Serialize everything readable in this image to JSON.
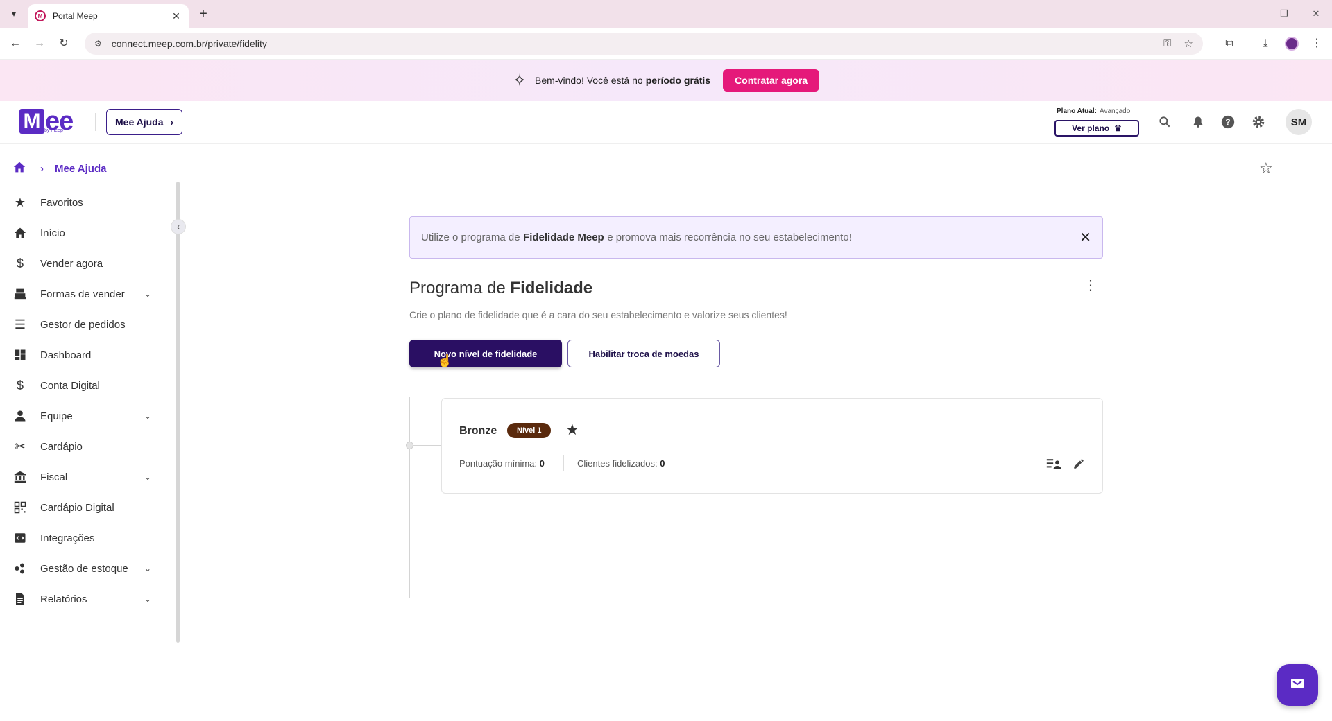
{
  "browser": {
    "tab_title": "Portal Meep",
    "url": "connect.meep.com.br/private/fidelity"
  },
  "promo": {
    "text": "Bem-vindo! Você está no",
    "strong": "período grátis",
    "button": "Contratar agora"
  },
  "header": {
    "logo_text": "ee",
    "logo_sub": "by meep",
    "help_button": "Mee Ajuda",
    "plan_label": "Plano Atual:",
    "plan_value": "Avançado",
    "plan_button": "Ver plano",
    "avatar_initials": "SM"
  },
  "breadcrumb": {
    "current": "Mee Ajuda"
  },
  "sidebar": {
    "items": [
      {
        "label": "Favoritos"
      },
      {
        "label": "Início"
      },
      {
        "label": "Vender agora"
      },
      {
        "label": "Formas de vender"
      },
      {
        "label": "Gestor de pedidos"
      },
      {
        "label": "Dashboard"
      },
      {
        "label": "Conta Digital"
      },
      {
        "label": "Equipe"
      },
      {
        "label": "Cardápio"
      },
      {
        "label": "Fiscal"
      },
      {
        "label": "Cardápio Digital"
      },
      {
        "label": "Integrações"
      },
      {
        "label": "Gestão de estoque"
      },
      {
        "label": "Relatórios"
      }
    ]
  },
  "main": {
    "info_banner": {
      "text_before": "Utilize o programa de",
      "strong": "Fidelidade Meep",
      "text_after": "e promova mais recorrência no seu estabelecimento!"
    },
    "title_prefix": "Programa de",
    "title_strong": "Fidelidade",
    "subtitle": "Crie o plano de fidelidade que é a cara do seu estabelecimento e valorize seus clientes!",
    "primary_button": "Novo nível de fidelidade",
    "secondary_button": "Habilitar troca de moedas",
    "levels": [
      {
        "name": "Bronze",
        "badge": "Nível 1",
        "min_score_label": "Pontuação mínima:",
        "min_score": "0",
        "clients_label": "Clientes fidelizados:",
        "clients": "0"
      }
    ]
  },
  "colors": {
    "brand_purple": "#5b2bc4",
    "primary_button": "#2a0f63",
    "promo_button": "#e5197a",
    "level_badge": "#5a2a0d"
  },
  "icons": [
    "search-icon",
    "bell-icon",
    "help-icon",
    "gear-icon",
    "home-icon",
    "star-icon",
    "close-icon",
    "kebab-icon",
    "edit-icon",
    "customers-icon",
    "chat-icon"
  ]
}
